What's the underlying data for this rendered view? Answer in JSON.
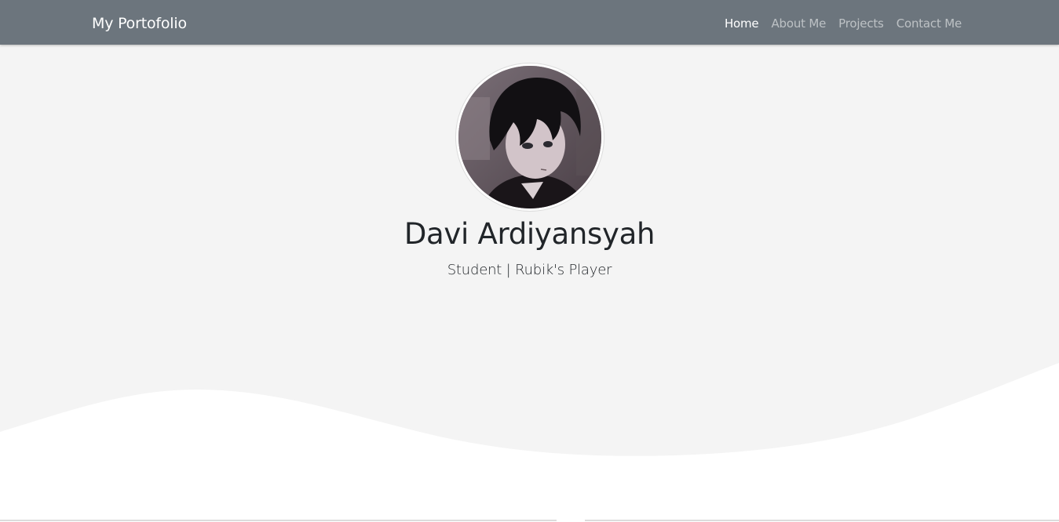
{
  "navbar": {
    "brand": "My Portofolio",
    "links": [
      {
        "label": "Home",
        "active": true
      },
      {
        "label": "About Me",
        "active": false
      },
      {
        "label": "Projects",
        "active": false
      },
      {
        "label": "Contact Me",
        "active": false
      }
    ]
  },
  "hero": {
    "avatar_icon": "profile-avatar-image",
    "name": "Davi Ardiyansyah",
    "subtitle": "Student | Rubik's Player"
  },
  "colors": {
    "navbar_bg": "#6c757d",
    "hero_bg": "#f4f4f4",
    "wave_fill": "#ffffff",
    "text": "#212529"
  }
}
